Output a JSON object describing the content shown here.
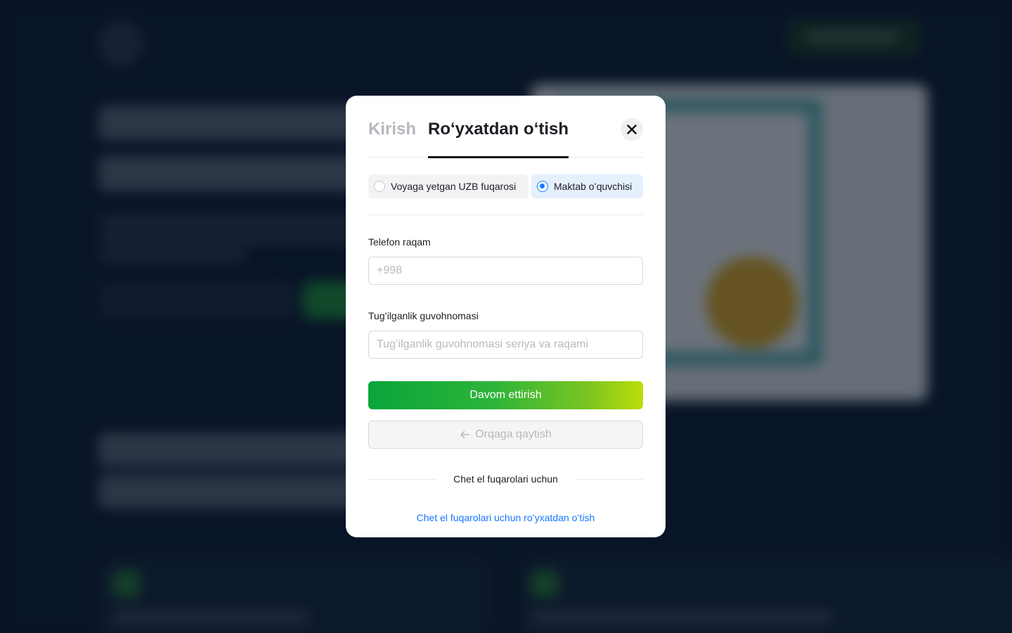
{
  "modal": {
    "tabs": [
      {
        "label": "Kirish",
        "active": false
      },
      {
        "label": "Roʻyxatdan oʻtish",
        "active": true
      }
    ],
    "close_icon": "close-icon",
    "user_types": [
      {
        "label": "Voyaga yetgan UZB fuqarosi",
        "selected": false
      },
      {
        "label": "Maktab oʻquvchisi",
        "selected": true
      }
    ],
    "phone": {
      "label": "Telefon raqam",
      "placeholder": "+998",
      "value": ""
    },
    "birth_certificate": {
      "label": "Tugʻilganlik guvohnomasi",
      "placeholder": "Tugʻilganlik guvohnomasi seriya va raqami",
      "value": ""
    },
    "continue_label": "Davom ettirish",
    "back_label": "Orqaga qaytish",
    "back_icon": "arrow-left-icon",
    "divider_text": "Chet el fuqarolari uchun",
    "foreign_link": "Chet el fuqarolari uchun roʻyxatdan oʻtish"
  },
  "colors": {
    "accent": "#1677ff",
    "primary_gradient_start": "#0aa53a",
    "primary_gradient_end": "#bcdd0a",
    "backdrop": "#0b1a30"
  }
}
